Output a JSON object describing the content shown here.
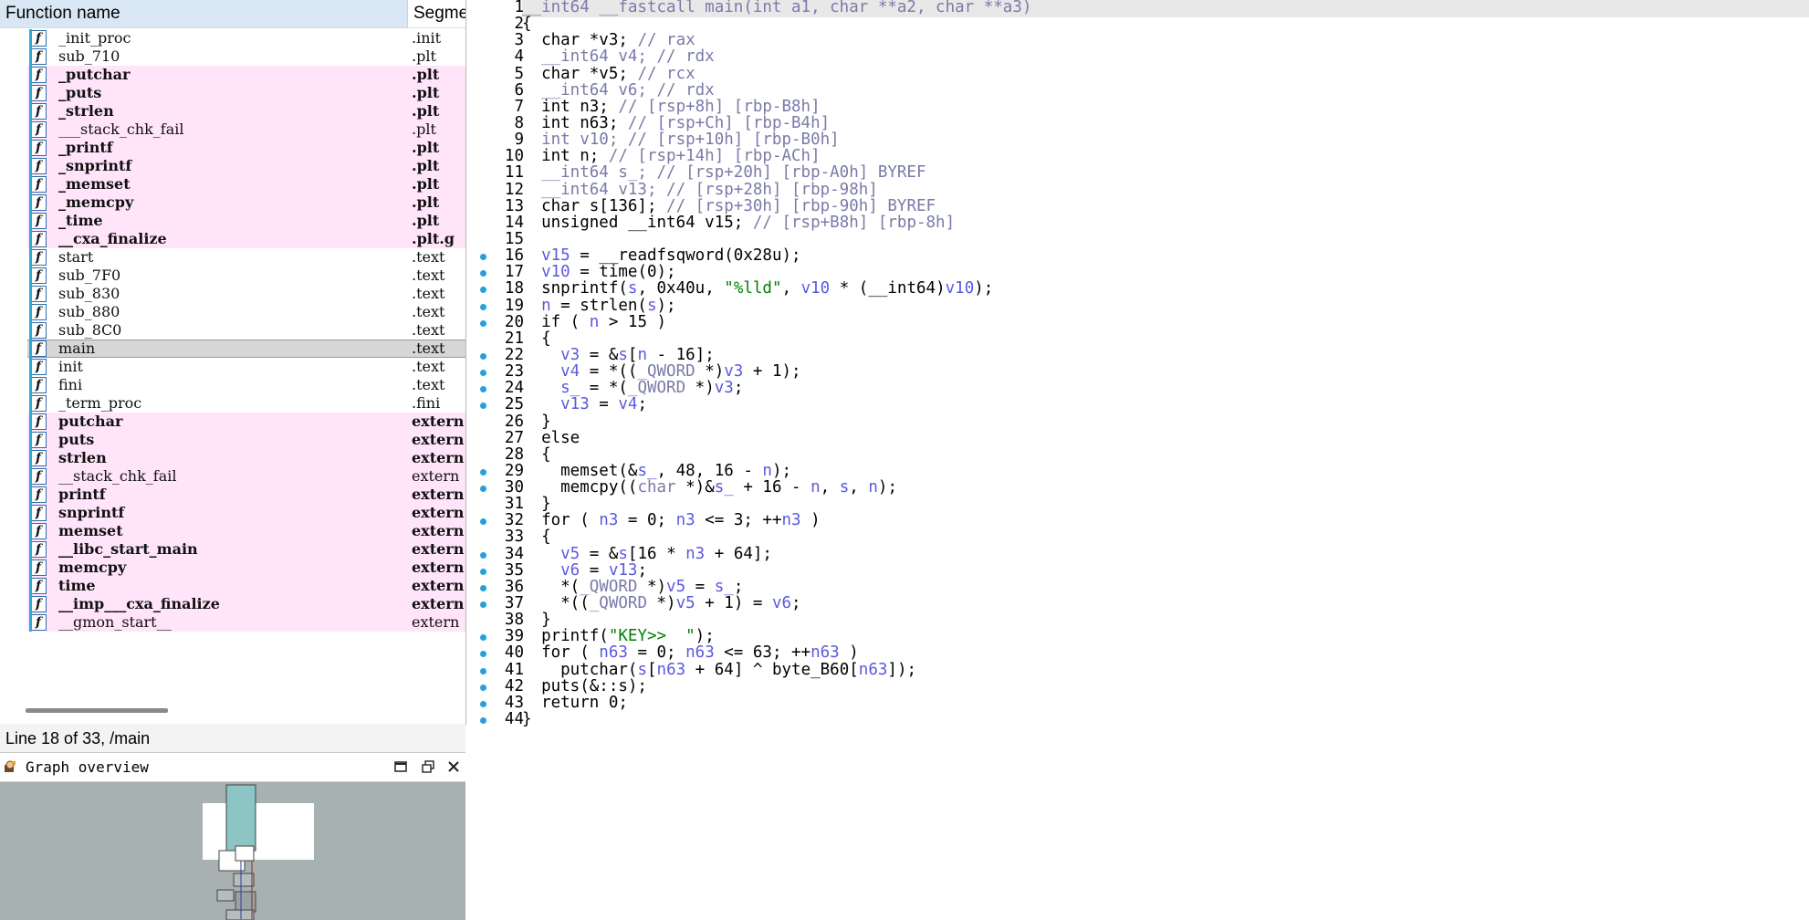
{
  "functions_window": {
    "column_name": "Function name",
    "column_segment": "Segme",
    "icon": "function-icon",
    "rows": [
      {
        "name": "_init_proc",
        "segment": ".init",
        "style": "normal"
      },
      {
        "name": "sub_710",
        "segment": ".plt",
        "style": "normal"
      },
      {
        "name": "_putchar",
        "segment": ".plt",
        "style": "lib"
      },
      {
        "name": "_puts",
        "segment": ".plt",
        "style": "lib"
      },
      {
        "name": "_strlen",
        "segment": ".plt",
        "style": "lib"
      },
      {
        "name": "___stack_chk_fail",
        "segment": ".plt",
        "style": "lib-thin"
      },
      {
        "name": "_printf",
        "segment": ".plt",
        "style": "lib"
      },
      {
        "name": "_snprintf",
        "segment": ".plt",
        "style": "lib"
      },
      {
        "name": "_memset",
        "segment": ".plt",
        "style": "lib"
      },
      {
        "name": "_memcpy",
        "segment": ".plt",
        "style": "lib"
      },
      {
        "name": "_time",
        "segment": ".plt",
        "style": "lib"
      },
      {
        "name": "__cxa_finalize",
        "segment": ".plt.g",
        "style": "lib"
      },
      {
        "name": "start",
        "segment": ".text",
        "style": "normal"
      },
      {
        "name": "sub_7F0",
        "segment": ".text",
        "style": "normal"
      },
      {
        "name": "sub_830",
        "segment": ".text",
        "style": "normal"
      },
      {
        "name": "sub_880",
        "segment": ".text",
        "style": "normal"
      },
      {
        "name": "sub_8C0",
        "segment": ".text",
        "style": "normal"
      },
      {
        "name": "main",
        "segment": ".text",
        "style": "selected"
      },
      {
        "name": "init",
        "segment": ".text",
        "style": "normal"
      },
      {
        "name": "fini",
        "segment": ".text",
        "style": "normal"
      },
      {
        "name": "_term_proc",
        "segment": ".fini",
        "style": "normal"
      },
      {
        "name": "putchar",
        "segment": "extern",
        "style": "lib"
      },
      {
        "name": "puts",
        "segment": "extern",
        "style": "lib"
      },
      {
        "name": "strlen",
        "segment": "extern",
        "style": "lib"
      },
      {
        "name": "__stack_chk_fail",
        "segment": "extern",
        "style": "lib-thin"
      },
      {
        "name": "printf",
        "segment": "extern",
        "style": "lib"
      },
      {
        "name": "snprintf",
        "segment": "extern",
        "style": "lib"
      },
      {
        "name": "memset",
        "segment": "extern",
        "style": "lib"
      },
      {
        "name": "__libc_start_main",
        "segment": "extern",
        "style": "lib"
      },
      {
        "name": "memcpy",
        "segment": "extern",
        "style": "lib"
      },
      {
        "name": "time",
        "segment": "extern",
        "style": "lib"
      },
      {
        "name": "__imp___cxa_finalize",
        "segment": "extern",
        "style": "lib"
      },
      {
        "name": "__gmon_start__",
        "segment": "extern",
        "style": "lib-thin"
      }
    ]
  },
  "status_line": "Line 18 of 33, /main",
  "graph_overview": {
    "title": "Graph overview",
    "icon": "graph-overview-icon",
    "buttons": [
      "maximize-icon",
      "restore-icon",
      "close-icon"
    ]
  },
  "colors": {
    "library_function_bg": "#ffe4fa",
    "selected_row_bg": "#d6d6d6",
    "header_bg": "#d9e7f5",
    "code_comment": "#7a7aa8",
    "code_variable": "#5a5adf",
    "code_string": "#008000",
    "code_number": "#000000",
    "breakpoint_dot": "#26a0da",
    "graph_bg": "#a8b1b1"
  },
  "pseudocode": {
    "lines": [
      {
        "num": "1",
        "bp": false,
        "segs": [
          [
            "cmt",
            "__int64 __fastcall main(int a1, char **a2, char **a3)"
          ]
        ]
      },
      {
        "num": "2",
        "bp": false,
        "segs": [
          [
            "plain",
            "{"
          ]
        ]
      },
      {
        "num": "3",
        "bp": false,
        "segs": [
          [
            "plain",
            "  char *v3; "
          ],
          [
            "cmt",
            "// rax"
          ]
        ]
      },
      {
        "num": "4",
        "bp": false,
        "segs": [
          [
            "cmt",
            "  __int64 v4; // rdx"
          ]
        ]
      },
      {
        "num": "5",
        "bp": false,
        "segs": [
          [
            "plain",
            "  char *v5; "
          ],
          [
            "cmt",
            "// rcx"
          ]
        ]
      },
      {
        "num": "6",
        "bp": false,
        "segs": [
          [
            "cmt",
            "  __int64 v6; // rdx"
          ]
        ]
      },
      {
        "num": "7",
        "bp": false,
        "segs": [
          [
            "plain",
            "  int n3; "
          ],
          [
            "cmt",
            "// [rsp+8h] [rbp-B8h]"
          ]
        ]
      },
      {
        "num": "8",
        "bp": false,
        "segs": [
          [
            "plain",
            "  int n63; "
          ],
          [
            "cmt",
            "// [rsp+Ch] [rbp-B4h]"
          ]
        ]
      },
      {
        "num": "9",
        "bp": false,
        "segs": [
          [
            "cmt",
            "  int v10; // [rsp+10h] [rbp-B0h]"
          ]
        ]
      },
      {
        "num": "10",
        "bp": false,
        "segs": [
          [
            "plain",
            "  int n; "
          ],
          [
            "cmt",
            "// [rsp+14h] [rbp-ACh]"
          ]
        ]
      },
      {
        "num": "11",
        "bp": false,
        "segs": [
          [
            "cmt",
            "  __int64 s_; // [rsp+20h] [rbp-A0h] BYREF"
          ]
        ]
      },
      {
        "num": "12",
        "bp": false,
        "segs": [
          [
            "cmt",
            "  __int64 v13; // [rsp+28h] [rbp-98h]"
          ]
        ]
      },
      {
        "num": "13",
        "bp": false,
        "segs": [
          [
            "plain",
            "  char s[136]; "
          ],
          [
            "cmt",
            "// [rsp+30h] [rbp-90h] BYREF"
          ]
        ]
      },
      {
        "num": "14",
        "bp": false,
        "segs": [
          [
            "plain",
            "  unsigned __int64 v15; "
          ],
          [
            "cmt",
            "// [rsp+B8h] [rbp-8h]"
          ]
        ]
      },
      {
        "num": "15",
        "bp": false,
        "segs": [
          [
            "plain",
            ""
          ]
        ]
      },
      {
        "num": "16",
        "bp": true,
        "segs": [
          [
            "var",
            "  v15"
          ],
          [
            "plain",
            " = __readfsqword(0x28u);"
          ]
        ]
      },
      {
        "num": "17",
        "bp": true,
        "segs": [
          [
            "var",
            "  v10"
          ],
          [
            "plain",
            " = time(0);"
          ]
        ]
      },
      {
        "num": "18",
        "bp": true,
        "segs": [
          [
            "plain",
            "  snprintf("
          ],
          [
            "var",
            "s"
          ],
          [
            "plain",
            ", 0x40u, "
          ],
          [
            "str",
            "\"%lld\""
          ],
          [
            "plain",
            ", "
          ],
          [
            "var",
            "v10"
          ],
          [
            "plain",
            " * (__int64)"
          ],
          [
            "var",
            "v10"
          ],
          [
            "plain",
            ");"
          ]
        ]
      },
      {
        "num": "19",
        "bp": true,
        "segs": [
          [
            "var",
            "  n"
          ],
          [
            "plain",
            " = strlen("
          ],
          [
            "var",
            "s"
          ],
          [
            "plain",
            ");"
          ]
        ]
      },
      {
        "num": "20",
        "bp": true,
        "segs": [
          [
            "plain",
            "  if ( "
          ],
          [
            "var",
            "n"
          ],
          [
            "plain",
            " > 15 )"
          ]
        ]
      },
      {
        "num": "21",
        "bp": false,
        "segs": [
          [
            "plain",
            "  {"
          ]
        ]
      },
      {
        "num": "22",
        "bp": true,
        "segs": [
          [
            "var",
            "    v3"
          ],
          [
            "plain",
            " = &"
          ],
          [
            "var",
            "s"
          ],
          [
            "plain",
            "["
          ],
          [
            "var",
            "n"
          ],
          [
            "plain",
            " - 16];"
          ]
        ]
      },
      {
        "num": "23",
        "bp": true,
        "segs": [
          [
            "var",
            "    v4"
          ],
          [
            "plain",
            " = *(("
          ],
          [
            "cmt",
            "_QWORD"
          ],
          [
            "plain",
            " *)"
          ],
          [
            "var",
            "v3"
          ],
          [
            "plain",
            " + 1);"
          ]
        ]
      },
      {
        "num": "24",
        "bp": true,
        "segs": [
          [
            "var",
            "    s_"
          ],
          [
            "plain",
            " = *("
          ],
          [
            "cmt",
            "_QWORD"
          ],
          [
            "plain",
            " *)"
          ],
          [
            "var",
            "v3"
          ],
          [
            "plain",
            ";"
          ]
        ]
      },
      {
        "num": "25",
        "bp": true,
        "segs": [
          [
            "var",
            "    v13"
          ],
          [
            "plain",
            " = "
          ],
          [
            "var",
            "v4"
          ],
          [
            "plain",
            ";"
          ]
        ]
      },
      {
        "num": "26",
        "bp": false,
        "segs": [
          [
            "plain",
            "  }"
          ]
        ]
      },
      {
        "num": "27",
        "bp": false,
        "segs": [
          [
            "plain",
            "  else"
          ]
        ]
      },
      {
        "num": "28",
        "bp": false,
        "segs": [
          [
            "plain",
            "  {"
          ]
        ]
      },
      {
        "num": "29",
        "bp": true,
        "segs": [
          [
            "plain",
            "    memset(&"
          ],
          [
            "var",
            "s_"
          ],
          [
            "plain",
            ", 48, 16 - "
          ],
          [
            "var",
            "n"
          ],
          [
            "plain",
            ");"
          ]
        ]
      },
      {
        "num": "30",
        "bp": true,
        "segs": [
          [
            "plain",
            "    memcpy(("
          ],
          [
            "cmt",
            "char"
          ],
          [
            "plain",
            " *)&"
          ],
          [
            "var",
            "s_"
          ],
          [
            "plain",
            " + 16 - "
          ],
          [
            "var",
            "n"
          ],
          [
            "plain",
            ", "
          ],
          [
            "var",
            "s"
          ],
          [
            "plain",
            ", "
          ],
          [
            "var",
            "n"
          ],
          [
            "plain",
            ");"
          ]
        ]
      },
      {
        "num": "31",
        "bp": false,
        "segs": [
          [
            "plain",
            "  }"
          ]
        ]
      },
      {
        "num": "32",
        "bp": true,
        "segs": [
          [
            "plain",
            "  for ( "
          ],
          [
            "var",
            "n3"
          ],
          [
            "plain",
            " = 0; "
          ],
          [
            "var",
            "n3"
          ],
          [
            "plain",
            " <= 3; ++"
          ],
          [
            "var",
            "n3"
          ],
          [
            "plain",
            " )"
          ]
        ]
      },
      {
        "num": "33",
        "bp": false,
        "segs": [
          [
            "plain",
            "  {"
          ]
        ]
      },
      {
        "num": "34",
        "bp": true,
        "segs": [
          [
            "var",
            "    v5"
          ],
          [
            "plain",
            " = &"
          ],
          [
            "var",
            "s"
          ],
          [
            "plain",
            "[16 * "
          ],
          [
            "var",
            "n3"
          ],
          [
            "plain",
            " + 64];"
          ]
        ]
      },
      {
        "num": "35",
        "bp": true,
        "segs": [
          [
            "var",
            "    v6"
          ],
          [
            "plain",
            " = "
          ],
          [
            "var",
            "v13"
          ],
          [
            "plain",
            ";"
          ]
        ]
      },
      {
        "num": "36",
        "bp": true,
        "segs": [
          [
            "plain",
            "    *("
          ],
          [
            "cmt",
            "_QWORD"
          ],
          [
            "plain",
            " *)"
          ],
          [
            "var",
            "v5"
          ],
          [
            "plain",
            " = "
          ],
          [
            "var",
            "s_"
          ],
          [
            "plain",
            ";"
          ]
        ]
      },
      {
        "num": "37",
        "bp": true,
        "segs": [
          [
            "plain",
            "    *(("
          ],
          [
            "cmt",
            "_QWORD"
          ],
          [
            "plain",
            " *)"
          ],
          [
            "var",
            "v5"
          ],
          [
            "plain",
            " + 1) = "
          ],
          [
            "var",
            "v6"
          ],
          [
            "plain",
            ";"
          ]
        ]
      },
      {
        "num": "38",
        "bp": false,
        "segs": [
          [
            "plain",
            "  }"
          ]
        ]
      },
      {
        "num": "39",
        "bp": true,
        "segs": [
          [
            "plain",
            "  printf("
          ],
          [
            "str",
            "\"KEY>>  \""
          ],
          [
            "plain",
            ");"
          ]
        ]
      },
      {
        "num": "40",
        "bp": true,
        "segs": [
          [
            "plain",
            "  for ( "
          ],
          [
            "var",
            "n63"
          ],
          [
            "plain",
            " = 0; "
          ],
          [
            "var",
            "n63"
          ],
          [
            "plain",
            " <= 63; ++"
          ],
          [
            "var",
            "n63"
          ],
          [
            "plain",
            " )"
          ]
        ]
      },
      {
        "num": "41",
        "bp": true,
        "segs": [
          [
            "plain",
            "    putchar("
          ],
          [
            "var",
            "s"
          ],
          [
            "plain",
            "["
          ],
          [
            "var",
            "n63"
          ],
          [
            "plain",
            " + 64] ^ byte_B60["
          ],
          [
            "var",
            "n63"
          ],
          [
            "plain",
            "]);"
          ]
        ]
      },
      {
        "num": "42",
        "bp": true,
        "segs": [
          [
            "plain",
            "  puts(&::s);"
          ]
        ]
      },
      {
        "num": "43",
        "bp": true,
        "segs": [
          [
            "plain",
            "  return 0;"
          ]
        ]
      },
      {
        "num": "44",
        "bp": true,
        "segs": [
          [
            "plain",
            "}"
          ]
        ]
      }
    ]
  }
}
